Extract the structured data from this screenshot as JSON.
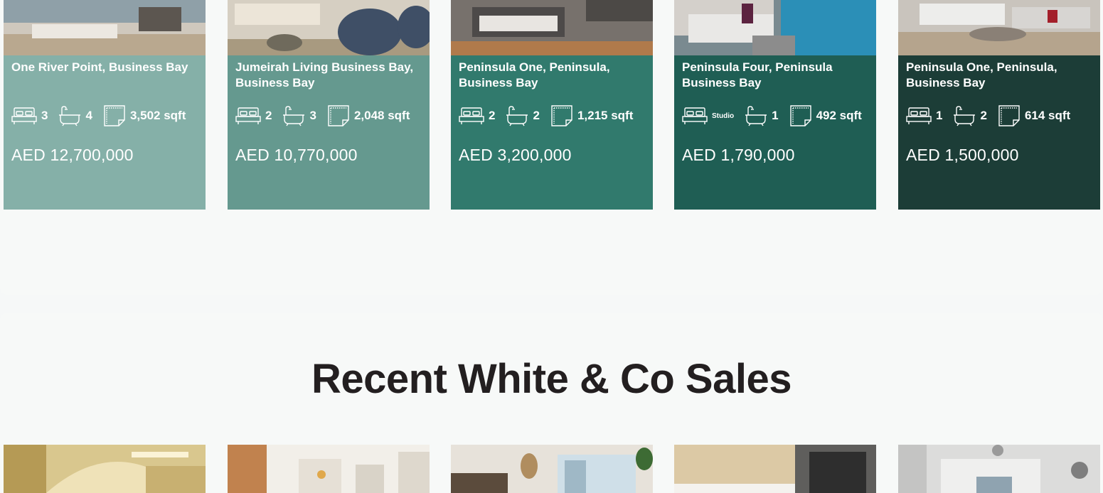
{
  "colors": {
    "card_1": "#85b0a8",
    "card_2": "#65998f",
    "card_3": "#317a6d",
    "card_4": "#1f5e54",
    "card_5": "#1c3d37",
    "heading": "#231f20"
  },
  "listings": [
    {
      "title": "One River Point, Business Bay",
      "beds": "3",
      "baths": "4",
      "area": "3,502 sqft",
      "price": "AED 12,700,000"
    },
    {
      "title": "Jumeirah Living Business Bay, Business Bay",
      "beds": "2",
      "baths": "3",
      "area": "2,048 sqft",
      "price": "AED 10,770,000"
    },
    {
      "title": "Peninsula One, Peninsula, Business Bay",
      "beds": "2",
      "baths": "2",
      "area": "1,215 sqft",
      "price": "AED 3,200,000"
    },
    {
      "title": "Peninsula Four, Peninsula Business Bay",
      "beds": "Studio",
      "baths": "1",
      "area": "492 sqft",
      "price": "AED 1,790,000"
    },
    {
      "title": "Peninsula One, Peninsula, Business Bay",
      "beds": "1",
      "baths": "2",
      "area": "614 sqft",
      "price": "AED 1,500,000"
    }
  ],
  "recent_sales": {
    "heading": "Recent White & Co Sales"
  },
  "icons": {
    "bed": "bed-icon",
    "bath": "bathtub-icon",
    "area": "floorplan-icon"
  }
}
